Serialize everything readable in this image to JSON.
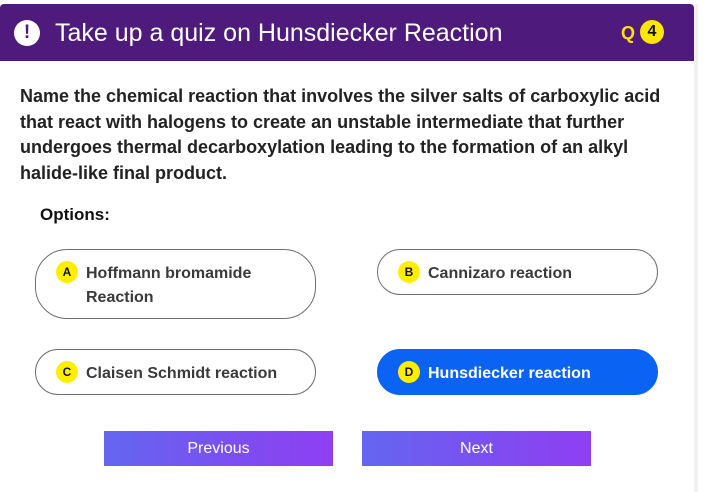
{
  "header": {
    "icon": "exclamation-icon",
    "title": "Take up a quiz on Hunsdiecker Reaction",
    "q_label": "Q",
    "q_number": "4",
    "colors": {
      "background": "#4e1a7c",
      "badge": "#ffe600"
    }
  },
  "question": {
    "text": "Name the chemical reaction that involves the silver salts of carboxylic acid that react with halogens to create an unstable intermediate that further undergoes thermal decarboxylation leading to the formation of an alkyl halide-like final product."
  },
  "options_label": "Options:",
  "options": [
    {
      "letter": "A",
      "text": "Hoffmann bromamide Reaction",
      "selected": false
    },
    {
      "letter": "B",
      "text": "Cannizaro reaction",
      "selected": false
    },
    {
      "letter": "C",
      "text": "Claisen Schmidt reaction",
      "selected": false
    },
    {
      "letter": "D",
      "text": "Hunsdiecker reaction",
      "selected": true
    }
  ],
  "navigation": {
    "previous_label": "Previous",
    "next_label": "Next"
  },
  "colors": {
    "selected_option": "#0a63f2",
    "option_badge": "#ffee00",
    "button_gradient": [
      "#6466f0",
      "#8f3ff2"
    ]
  }
}
